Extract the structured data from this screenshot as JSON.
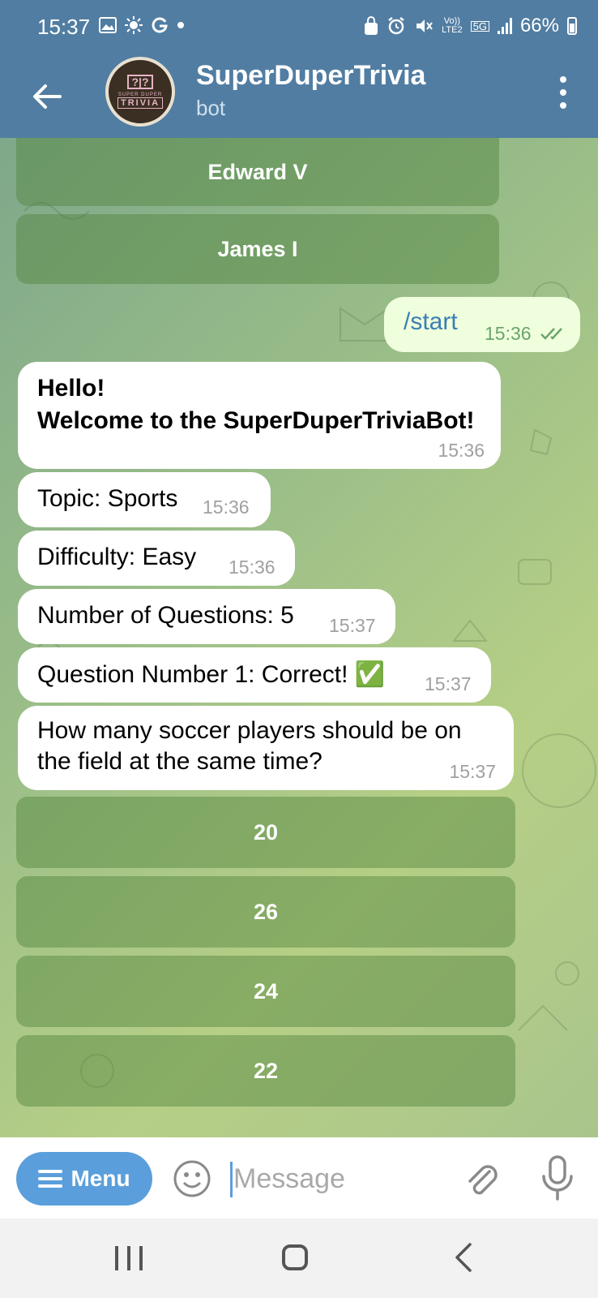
{
  "status_bar": {
    "time": "15:37",
    "left_icons": [
      "image-icon",
      "brightness-icon",
      "google-icon",
      "dot-icon"
    ],
    "network_small_top": "Vo))",
    "network_small_bottom": "LTE2",
    "net_5g": "5G",
    "battery": "66%"
  },
  "header": {
    "title": "SuperDuperTrivia",
    "subtitle": "bot",
    "avatar_small_text": "SUPER DUPER",
    "avatar_big_text": "TRIVIA",
    "avatar_q_text": "?|?"
  },
  "prev_keyboard": [
    "Edward V",
    "James I"
  ],
  "messages": [
    {
      "text": "/start",
      "time": "15:36",
      "outgoing": true
    },
    {
      "line1": "Hello!",
      "line2": "Welcome to the SuperDuperTriviaBot!",
      "time": "15:36"
    },
    {
      "text": "Topic: Sports",
      "time": "15:36"
    },
    {
      "text": "Difficulty: Easy",
      "time": "15:36"
    },
    {
      "text": "Number of Questions: 5",
      "time": "15:37"
    },
    {
      "text": "Question Number 1: Correct! ✅",
      "time": "15:37"
    },
    {
      "line1": "How many soccer players should be on",
      "line2": "the field at the same time?",
      "time": "15:37"
    }
  ],
  "answer_keyboard": [
    "20",
    "26",
    "24",
    "22"
  ],
  "input_bar": {
    "menu_label": "Menu",
    "placeholder": "Message"
  },
  "colors": {
    "header": "#517da2",
    "menu_button": "#5a9fdb",
    "outgoing_bubble": "#effedd"
  }
}
